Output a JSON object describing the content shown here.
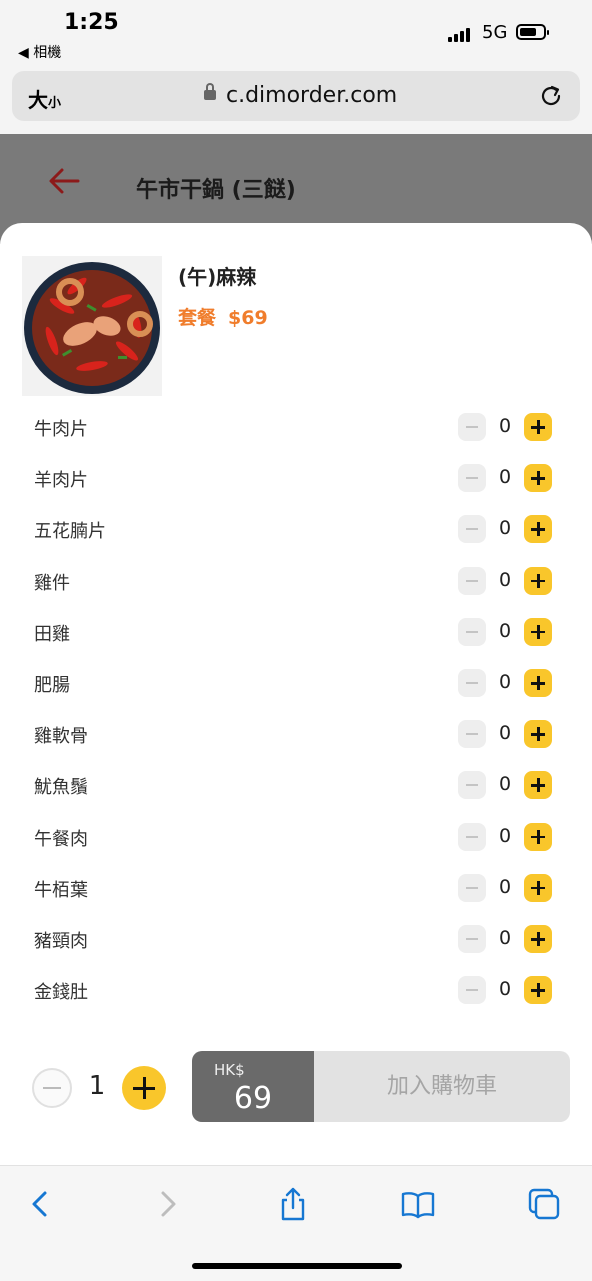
{
  "status_bar": {
    "time": "1:25",
    "back_app": "◀ 相機",
    "network": "5G"
  },
  "browser": {
    "text_size": "大",
    "text_size_small": "小",
    "url": "c.dimorder.com"
  },
  "page": {
    "title": "午市干鍋 (三餸)"
  },
  "dish": {
    "name": "(午)麻辣",
    "set_label": "套餐",
    "price": "$69"
  },
  "options": [
    {
      "label": "牛肉片",
      "qty": "0"
    },
    {
      "label": "羊肉片",
      "qty": "0"
    },
    {
      "label": "五花腩片",
      "qty": "0"
    },
    {
      "label": "雞件",
      "qty": "0"
    },
    {
      "label": "田雞",
      "qty": "0"
    },
    {
      "label": "肥腸",
      "qty": "0"
    },
    {
      "label": "雞軟骨",
      "qty": "0"
    },
    {
      "label": "魷魚鬚",
      "qty": "0"
    },
    {
      "label": "午餐肉",
      "qty": "0"
    },
    {
      "label": "牛栢葉",
      "qty": "0"
    },
    {
      "label": "豬頸肉",
      "qty": "0"
    },
    {
      "label": "金錢肚",
      "qty": "0"
    }
  ],
  "order": {
    "quantity": "1",
    "currency": "HK$",
    "total": "69",
    "add_to_cart": "加入購物車"
  },
  "colors": {
    "accent_yellow": "#f9c62b",
    "price_orange": "#f07d2c",
    "ios_blue": "#1677d2"
  }
}
